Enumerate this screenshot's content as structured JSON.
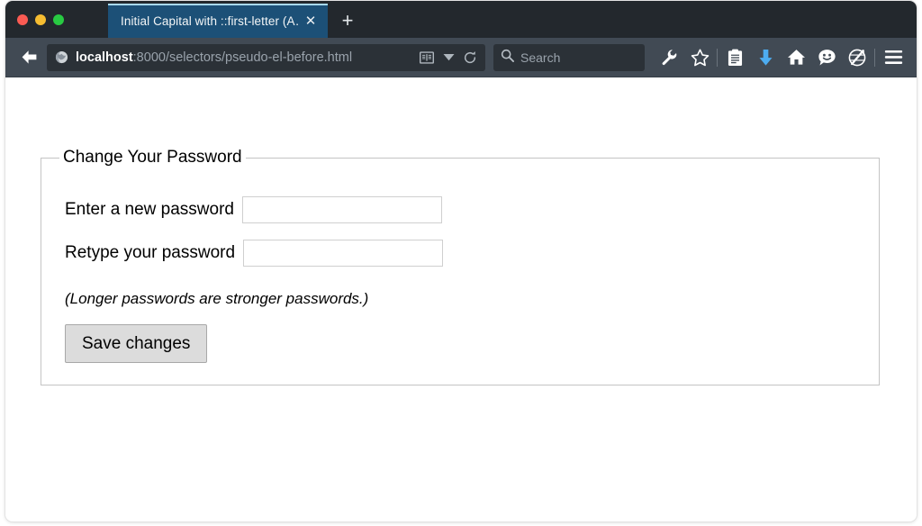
{
  "window": {
    "traffic_lights": [
      {
        "name": "close",
        "color": "#fb5b53"
      },
      {
        "name": "minimize",
        "color": "#f6bd31"
      },
      {
        "name": "maximize",
        "color": "#28ca42"
      }
    ]
  },
  "tab_strip": {
    "tabs": [
      {
        "title": "Initial Capital with ::first-letter (A…",
        "close_label": "✕",
        "active": true
      }
    ],
    "new_tab_label": "+"
  },
  "toolbar": {
    "back_label": "←",
    "url": {
      "host": "localhost",
      "path": ":8000/selectors/pseudo-el-before.html",
      "identity_icon": "globe-icon",
      "reader_icon": "reader-mode-icon",
      "dropdown_icon": "chevron-down-icon",
      "reload_icon": "reload-icon"
    },
    "search": {
      "placeholder": "Search",
      "icon": "search-icon"
    },
    "icons": [
      {
        "name": "wrench-icon",
        "color": "#ffffff"
      },
      {
        "name": "star-icon",
        "color": "#ffffff"
      },
      {
        "name": "divider",
        "color": "#6a737c"
      },
      {
        "name": "reading-list-icon",
        "color": "#ffffff"
      },
      {
        "name": "download-arrow-icon",
        "color": "#4dacf0"
      },
      {
        "name": "home-icon",
        "color": "#ffffff"
      },
      {
        "name": "feedback-smiley-icon",
        "color": "#ffffff"
      },
      {
        "name": "pocket-globe-pen-icon",
        "color": "#ffffff"
      },
      {
        "name": "divider",
        "color": "#6a737c"
      },
      {
        "name": "hamburger-menu-icon",
        "color": "#ffffff"
      }
    ]
  },
  "page": {
    "fieldset_legend": "Change Your Password",
    "fields": [
      {
        "label": "Enter a new password",
        "value": "",
        "placeholder": ""
      },
      {
        "label": "Retype your password",
        "value": "",
        "placeholder": ""
      }
    ],
    "hint": "(Longer passwords are stronger passwords.)",
    "submit_label": "Save changes"
  }
}
